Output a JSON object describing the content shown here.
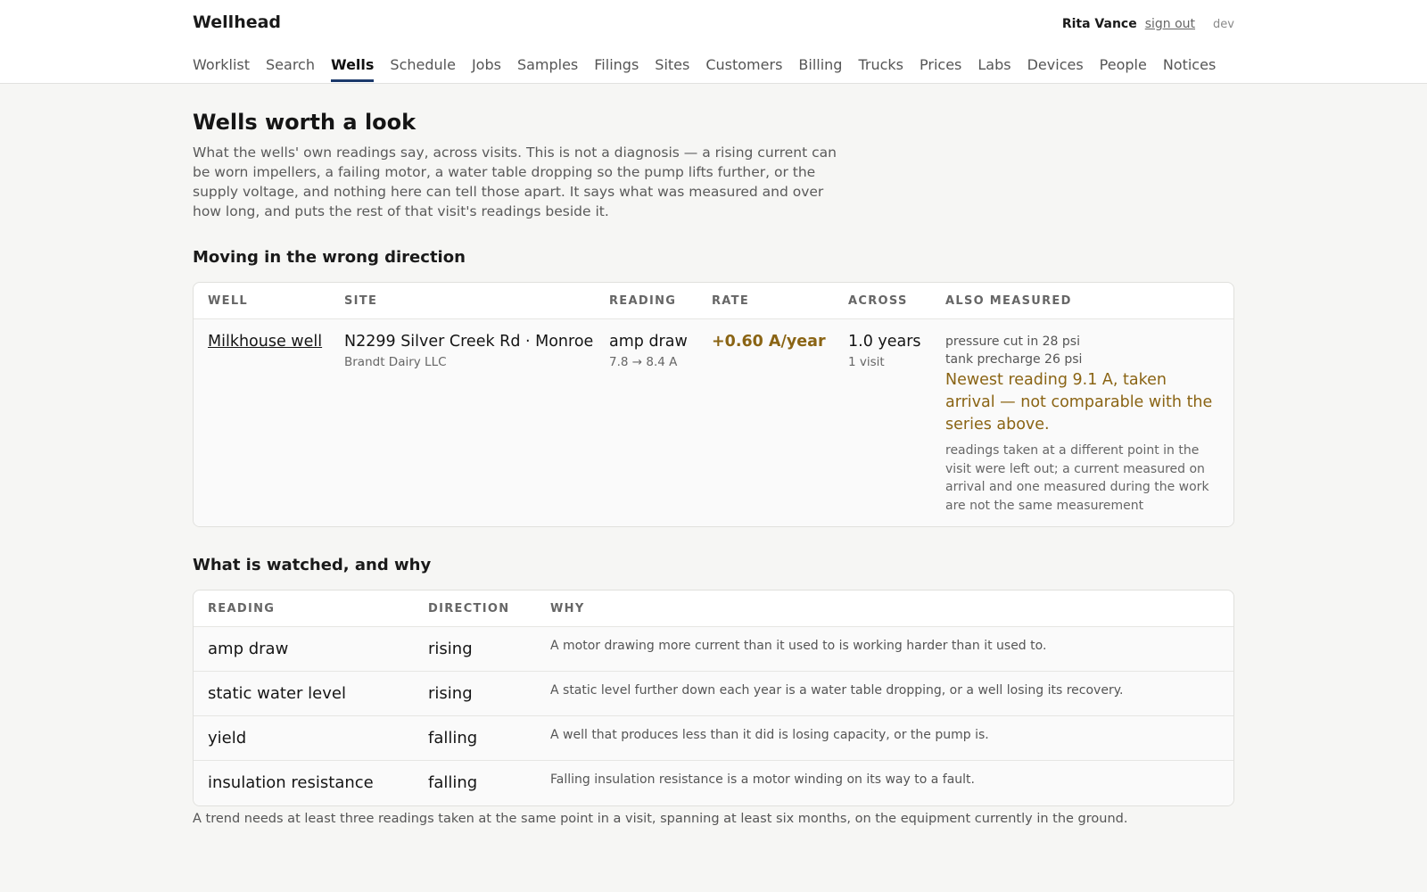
{
  "app": {
    "brand": "Wellhead"
  },
  "account": {
    "user": "Rita Vance",
    "sign_out": "sign out",
    "env": "dev"
  },
  "nav": {
    "items": [
      {
        "label": "Worklist",
        "name": "nav-worklist"
      },
      {
        "label": "Search",
        "name": "nav-search"
      },
      {
        "label": "Wells",
        "name": "nav-wells",
        "active": true
      },
      {
        "label": "Schedule",
        "name": "nav-schedule"
      },
      {
        "label": "Jobs",
        "name": "nav-jobs"
      },
      {
        "label": "Samples",
        "name": "nav-samples"
      },
      {
        "label": "Filings",
        "name": "nav-filings"
      },
      {
        "label": "Sites",
        "name": "nav-sites"
      },
      {
        "label": "Customers",
        "name": "nav-customers"
      },
      {
        "label": "Billing",
        "name": "nav-billing"
      },
      {
        "label": "Trucks",
        "name": "nav-trucks"
      },
      {
        "label": "Prices",
        "name": "nav-prices"
      },
      {
        "label": "Labs",
        "name": "nav-labs"
      },
      {
        "label": "Devices",
        "name": "nav-devices"
      },
      {
        "label": "People",
        "name": "nav-people"
      },
      {
        "label": "Notices",
        "name": "nav-notices"
      }
    ]
  },
  "page": {
    "title": "Wells worth a look",
    "intro": "What the wells' own readings say, across visits. This is not a diagnosis — a rising current can be worn impellers, a failing motor, a water table dropping so the pump lifts further, or the supply voltage, and nothing here can tell those apart. It says what was measured and over how long, and puts the rest of that visit's readings beside it."
  },
  "trending": {
    "title": "Moving in the wrong direction",
    "headers": {
      "well": "Well",
      "site": "Site",
      "reading": "Reading",
      "rate": "Rate",
      "across": "Across",
      "also": "Also measured"
    },
    "rows": [
      {
        "well": "Milkhouse well",
        "site": "N2299 Silver Creek Rd · Monroe",
        "customer": "Brandt Dairy LLC",
        "reading": "amp draw",
        "reading_range": "7.8 → 8.4 A",
        "rate": "+0.60 A/year",
        "across": "1.0 years",
        "visits": "1 visit",
        "also": [
          "pressure cut in 28 psi",
          "tank precharge 26 psi"
        ],
        "warning": "Newest reading 9.1 A, taken arrival — not comparable with the series above.",
        "note": "readings taken at a different point in the visit were left out; a current measured on arrival and one measured during the work are not the same measurement"
      }
    ]
  },
  "watched": {
    "title": "What is watched, and why",
    "headers": {
      "reading": "Reading",
      "direction": "Direction",
      "why": "Why"
    },
    "rows": [
      {
        "reading": "amp draw",
        "direction": "rising",
        "why": "A motor drawing more current than it used to is working harder than it used to."
      },
      {
        "reading": "static water level",
        "direction": "rising",
        "why": "A static level further down each year is a water table dropping, or a well losing its recovery."
      },
      {
        "reading": "yield",
        "direction": "falling",
        "why": "A well that produces less than it did is losing capacity, or the pump is."
      },
      {
        "reading": "insulation resistance",
        "direction": "falling",
        "why": "Falling insulation resistance is a motor winding on its way to a fault."
      }
    ],
    "footnote": "A trend needs at least three readings taken at the same point in a visit, spanning at least six months, on the equipment currently in the ground."
  },
  "colors": {
    "accent": "#1c3a6b",
    "warning": "#8a6414",
    "link": "#1f3d6e"
  }
}
